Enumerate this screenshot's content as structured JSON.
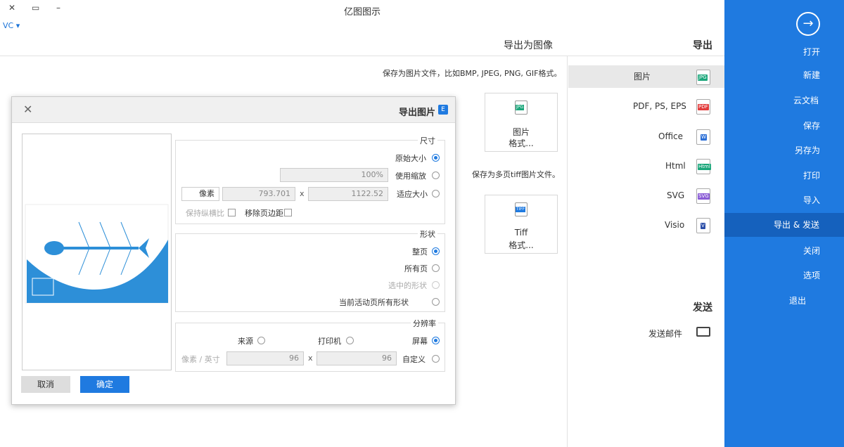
{
  "window": {
    "title": "亿图图示",
    "min": "–",
    "max": "▭",
    "close": "✕",
    "vc": "VC ▾"
  },
  "header": {
    "export_title": "导出为图像",
    "section": "导出"
  },
  "sidebar": {
    "back": "→",
    "items": [
      "打开",
      "新建",
      "云文档",
      "保存",
      "另存为",
      "打印",
      "导入",
      "导出 & 发送",
      "关闭",
      "选项",
      "退出"
    ],
    "active_index": 7
  },
  "formats": {
    "items": [
      {
        "label": "图片",
        "badge": "JPG",
        "color": "#1aa67a"
      },
      {
        "label": "PDF, PS, EPS",
        "badge": "PDF",
        "color": "#e23b3b"
      },
      {
        "label": "Office",
        "badge": "W",
        "color": "#2b6fd6"
      },
      {
        "label": "Html",
        "badge": "Html",
        "color": "#1aa67a"
      },
      {
        "label": "SVG",
        "badge": "SVG",
        "color": "#8a5cd6"
      },
      {
        "label": "Visio",
        "badge": "V",
        "color": "#2b4ea8"
      }
    ],
    "selected_index": 0
  },
  "send": {
    "title": "发送",
    "mail": "发送邮件"
  },
  "content": {
    "desc1": "保存为图片文件，比如BMP, JPEG, PNG, GIF格式。",
    "desc2": "保存为多页tiff图片文件。",
    "card1": {
      "badge": "JPG",
      "line1": "图片",
      "line2": "格式..."
    },
    "card2": {
      "badge": "TIFF",
      "line1": "Tiff",
      "line2": "格式..."
    }
  },
  "dialog": {
    "title": "导出图片",
    "close": "✕",
    "size": {
      "label": "尺寸",
      "original": "原始大小",
      "zoom": "使用缩放",
      "fit": "适应大小",
      "zoom_value": "100%",
      "width": "1122.52",
      "height": "793.701",
      "unit": "像素",
      "remove_margin": "移除页边距",
      "keep_ratio": "保持纵横比",
      "x": "x"
    },
    "shape": {
      "label": "形状",
      "full": "整页",
      "all": "所有页",
      "selected": "选中的形状",
      "current": "当前活动页所有形状"
    },
    "resolution": {
      "label": "分辨率",
      "screen": "屏幕",
      "printer": "打印机",
      "source": "来源",
      "custom": "自定义",
      "dpi_x": "96",
      "dpi_y": "96",
      "unit": "像素 / 英寸",
      "x": "x"
    },
    "ok": "确定",
    "cancel": "取消"
  }
}
